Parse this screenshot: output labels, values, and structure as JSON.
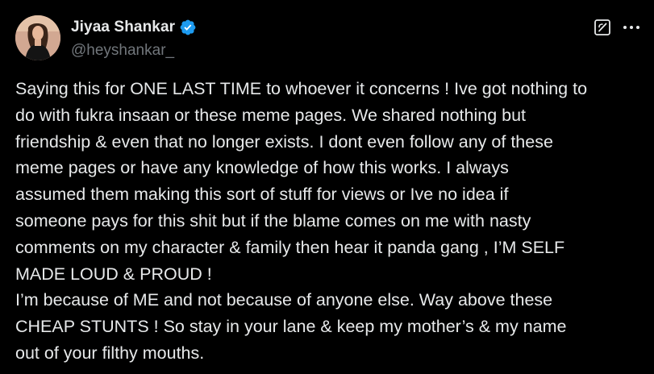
{
  "author": {
    "display_name": "Jiyaa Shankar",
    "handle": "@heyshankar_",
    "verified_icon": "verified-badge-icon",
    "verified_color": "#1d9bf0"
  },
  "actions": {
    "grok_icon": "grok-icon",
    "more_icon": "more-options-icon"
  },
  "tweet": {
    "text": "Saying this for ONE LAST TIME to whoever it concerns ! Ive got nothing to\ndo with fukra insaan or these meme pages. We shared nothing but\nfriendship & even that no longer exists. I dont even follow any of these\nmeme pages or have any knowledge of how this works. I always\nassumed them making this sort of stuff for views or Ive no idea if\nsomeone pays for this shit but if the blame comes on me with nasty\ncomments on my character & family then hear it panda gang , I’M SELF\nMADE LOUD & PROUD !\nI’m because of ME and not because of anyone else. Way above these\nCHEAP STUNTS ! So stay in your lane & keep my mother’s & my name\nout of your filthy mouths."
  },
  "colors": {
    "background": "#000000",
    "text_primary": "#e7e9ea",
    "text_secondary": "#71767b"
  }
}
